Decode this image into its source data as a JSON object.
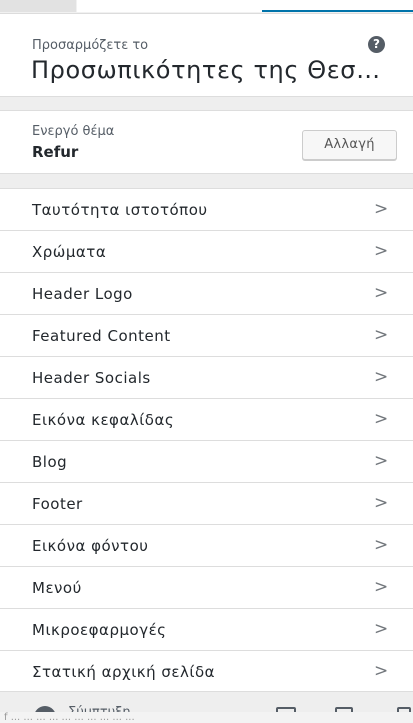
{
  "header": {
    "customizing_label": "Προσαρμόζετε το",
    "site_title": "Προσωπικότητες της Θεσσ...",
    "help_icon": "question-circle-icon"
  },
  "theme": {
    "label": "Ενεργό θέμα",
    "name": "Refur",
    "change_label": "Αλλαγή"
  },
  "sections": [
    {
      "label": "Ταυτότητα ιστοτόπου"
    },
    {
      "label": "Χρώματα"
    },
    {
      "label": "Header Logo"
    },
    {
      "label": "Featured Content"
    },
    {
      "label": "Header Socials"
    },
    {
      "label": "Εικόνα κεφαλίδας"
    },
    {
      "label": "Blog"
    },
    {
      "label": "Footer"
    },
    {
      "label": "Εικόνα φόντου"
    },
    {
      "label": "Μενού"
    },
    {
      "label": "Μικροεφαρμογές"
    },
    {
      "label": "Στατική αρχική σελίδα"
    }
  ],
  "chevron_glyph": ">",
  "footer": {
    "collapse_label": "Σύμπτυξη",
    "notice_text": "f ... ... ... ... ... ... ... ... ... ..."
  },
  "colors": {
    "accent": "#0073aa",
    "text": "#23282d",
    "muted": "#555d66",
    "panel_bg": "#eeeeee"
  }
}
